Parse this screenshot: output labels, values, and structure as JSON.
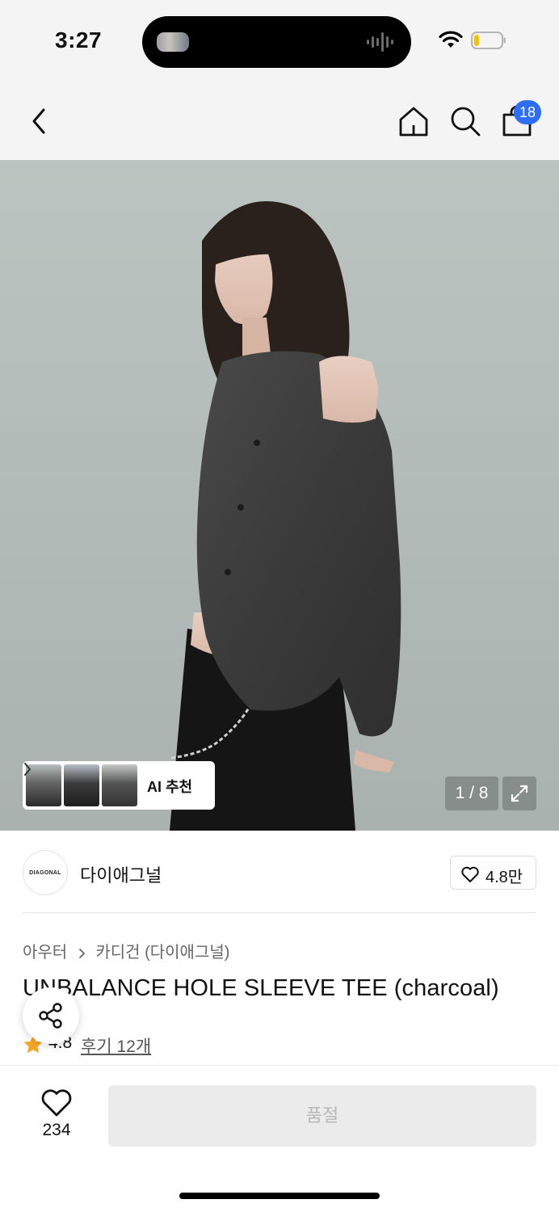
{
  "status_bar": {
    "time": "3:27"
  },
  "nav": {
    "cart_count": "18"
  },
  "hero": {
    "ai_recommend_label": "AI 추천",
    "page_counter": "1 / 8"
  },
  "brand": {
    "logo_text": "DIAGONAL",
    "name": "다이애그널",
    "likes": "4.8만"
  },
  "product": {
    "breadcrumb": [
      "아우터",
      "카디건 (다이애그널)"
    ],
    "title": "UNBALANCE HOLE SLEEVE TEE (charcoal)",
    "rating": "4.8",
    "reviews": "후기 12개"
  },
  "bottom": {
    "wish_count": "234",
    "soldout_label": "품절"
  },
  "colors": {
    "badge": "#2e6ef7",
    "star": "#f7a623",
    "soldout_bg": "#ebebeb"
  }
}
